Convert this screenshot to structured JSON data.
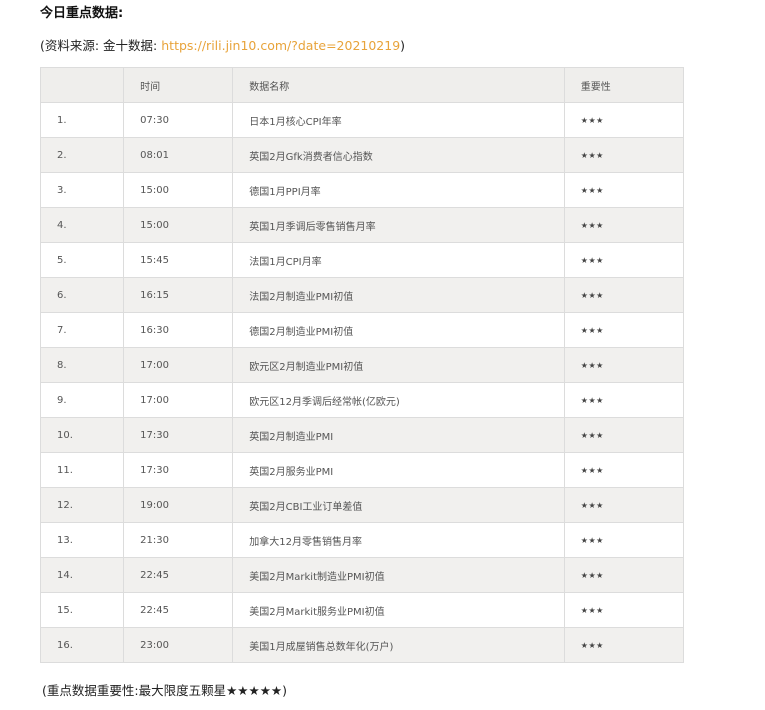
{
  "title": "今日重点数据:",
  "source": {
    "prefix": "(资料来源: 金十数据: ",
    "link": "https://rili.jin10.com/?date=20210219",
    "suffix": ")"
  },
  "table": {
    "headers": [
      "",
      "时间",
      "数据名称",
      "重要性"
    ],
    "rows": [
      {
        "num": "1.",
        "time": "07:30",
        "name": "日本1月核心CPI年率",
        "importance": "★★★"
      },
      {
        "num": "2.",
        "time": "08:01",
        "name": "英国2月Gfk消费者信心指数",
        "importance": "★★★"
      },
      {
        "num": "3.",
        "time": "15:00",
        "name": "德国1月PPI月率",
        "importance": "★★★"
      },
      {
        "num": "4.",
        "time": "15:00",
        "name": "英国1月季调后零售销售月率",
        "importance": "★★★"
      },
      {
        "num": "5.",
        "time": "15:45",
        "name": "法国1月CPI月率",
        "importance": "★★★"
      },
      {
        "num": "6.",
        "time": "16:15",
        "name": "法国2月制造业PMI初值",
        "importance": "★★★"
      },
      {
        "num": "7.",
        "time": "16:30",
        "name": "德国2月制造业PMI初值",
        "importance": "★★★"
      },
      {
        "num": "8.",
        "time": "17:00",
        "name": "欧元区2月制造业PMI初值",
        "importance": "★★★"
      },
      {
        "num": "9.",
        "time": "17:00",
        "name": "欧元区12月季调后经常帐(亿欧元)",
        "importance": "★★★"
      },
      {
        "num": "10.",
        "time": "17:30",
        "name": "英国2月制造业PMI",
        "importance": "★★★"
      },
      {
        "num": "11.",
        "time": "17:30",
        "name": "英国2月服务业PMI",
        "importance": "★★★"
      },
      {
        "num": "12.",
        "time": "19:00",
        "name": "英国2月CBI工业订单差值",
        "importance": "★★★"
      },
      {
        "num": "13.",
        "time": "21:30",
        "name": "加拿大12月零售销售月率",
        "importance": "★★★"
      },
      {
        "num": "14.",
        "time": "22:45",
        "name": "美国2月Markit制造业PMI初值",
        "importance": "★★★"
      },
      {
        "num": "15.",
        "time": "22:45",
        "name": "美国2月Markit服务业PMI初值",
        "importance": "★★★"
      },
      {
        "num": "16.",
        "time": "23:00",
        "name": "美国1月成屋销售总数年化(万户)",
        "importance": "★★★"
      }
    ]
  },
  "note": "(重点数据重要性:最大限度五颗星★★★★★)",
  "colors": {
    "link": "#e8a33a",
    "header_bg": "#efeeec",
    "stripe_bg": "#f1f0ee",
    "border": "#dcdcdc"
  }
}
